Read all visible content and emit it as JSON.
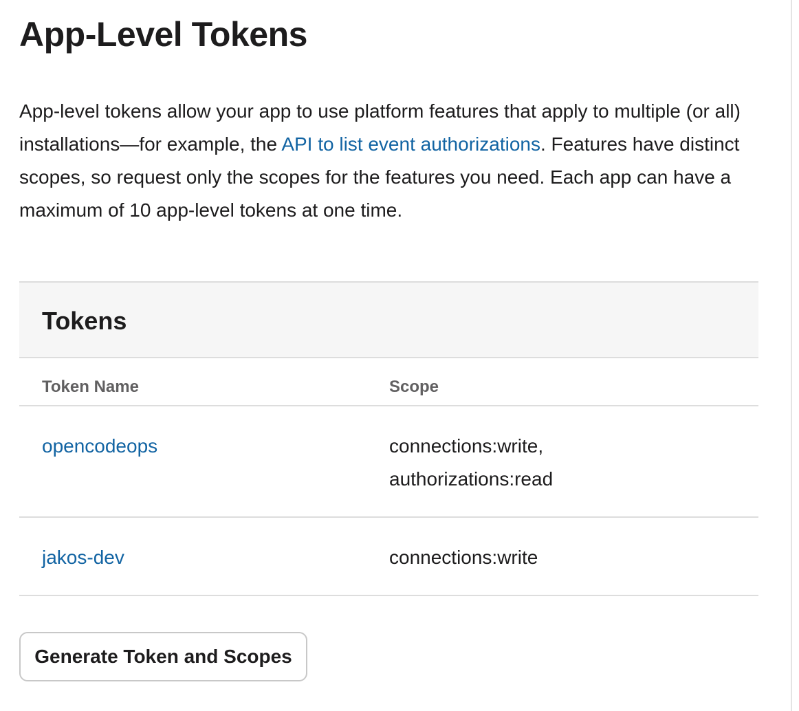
{
  "page": {
    "title": "App-Level Tokens",
    "intro_before_link": "App-level tokens allow your app to use platform features that apply to multiple (or all) installations—for example, the ",
    "intro_link": "API to list event authorizations",
    "intro_after_link": ". Features have distinct scopes, so request only the scopes for the features you need. Each app can have a maximum of 10 app-level tokens at one time."
  },
  "tokens": {
    "title": "Tokens",
    "columns": {
      "name": "Token Name",
      "scope": "Scope"
    },
    "rows": [
      {
        "name": "opencodeops",
        "scopes": [
          "connections:write,",
          "authorizations:read"
        ]
      },
      {
        "name": "jakos-dev",
        "scopes": [
          "connections:write"
        ]
      }
    ]
  },
  "actions": {
    "generate_label": "Generate Token and Scopes"
  },
  "colors": {
    "link": "#1264a3",
    "text": "#1d1c1d",
    "muted": "#616061",
    "panel_bg": "#f6f6f6",
    "divider": "#dddddd"
  }
}
